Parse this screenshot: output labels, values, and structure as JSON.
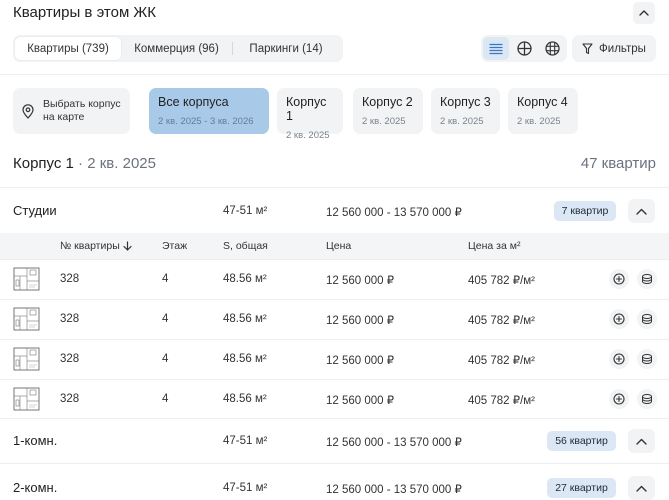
{
  "header": {
    "title": "Квартиры в этом ЖК"
  },
  "tabs": [
    {
      "label": "Квартиры (739)",
      "active": true
    },
    {
      "label": "Коммерция (96)",
      "active": false
    },
    {
      "label": "Паркинги (14)",
      "active": false
    }
  ],
  "toolbar": {
    "filters_label": "Фильтры"
  },
  "buildings": {
    "map_label_line1": "Выбрать корпус",
    "map_label_line2": "на карте",
    "items": [
      {
        "name": "Все корпуса",
        "period": "2 кв. 2025 - 3 кв. 2026",
        "active": true
      },
      {
        "name": "Корпус 1",
        "period": "2 кв. 2025",
        "active": false
      },
      {
        "name": "Корпус 2",
        "period": "2 кв. 2025",
        "active": false
      },
      {
        "name": "Корпус 3",
        "period": "2 кв. 2025",
        "active": false
      },
      {
        "name": "Корпус 4",
        "period": "2 кв. 2025",
        "active": false
      }
    ]
  },
  "section": {
    "title": "Корпус 1",
    "subtitle": " · 2 кв. 2025",
    "count": "47 квартир"
  },
  "groups": [
    {
      "label": "Студии",
      "area": "47-51 м²",
      "price": "12 560 000 - 13 570 000 ₽",
      "badge": "7 квартир",
      "expanded": true
    },
    {
      "label": "1-комн.",
      "area": "47-51 м²",
      "price": "12 560 000 - 13 570 000 ₽",
      "badge": "56 квартир",
      "expanded": false
    },
    {
      "label": "2-комн.",
      "area": "47-51 м²",
      "price": "12 560 000 - 13 570 000 ₽",
      "badge": "27 квартир",
      "expanded": false
    }
  ],
  "table": {
    "headers": {
      "number": "№ квартиры",
      "floor": "Этаж",
      "area": "S, общая",
      "price": "Цена",
      "price_per_m2": "Цена за м²"
    },
    "rows": [
      {
        "number": "328",
        "floor": "4",
        "area": "48.56 м²",
        "price": "12 560 000 ₽",
        "price_per_m2": "405 782 ₽/м²"
      },
      {
        "number": "328",
        "floor": "4",
        "area": "48.56 м²",
        "price": "12 560 000 ₽",
        "price_per_m2": "405 782 ₽/м²"
      },
      {
        "number": "328",
        "floor": "4",
        "area": "48.56 м²",
        "price": "12 560 000 ₽",
        "price_per_m2": "405 782 ₽/м²"
      },
      {
        "number": "328",
        "floor": "4",
        "area": "48.56 м²",
        "price": "12 560 000 ₽",
        "price_per_m2": "405 782 ₽/м²"
      }
    ]
  },
  "icons": {
    "collapse": "chevron-up-icon",
    "list_view": "list-icon",
    "grid_view": "grid-icon",
    "floor_view": "chessboard-icon",
    "filters": "filter-icon",
    "map": "map-pin-icon",
    "sort": "arrow-down-icon",
    "compare": "plus-circle-icon",
    "favorite": "stack-icon"
  },
  "colors": {
    "accent": "#a9c9e9",
    "badge": "#dbe7f5",
    "surface": "#f1f3f5",
    "primary_icon": "#3a78c2"
  }
}
